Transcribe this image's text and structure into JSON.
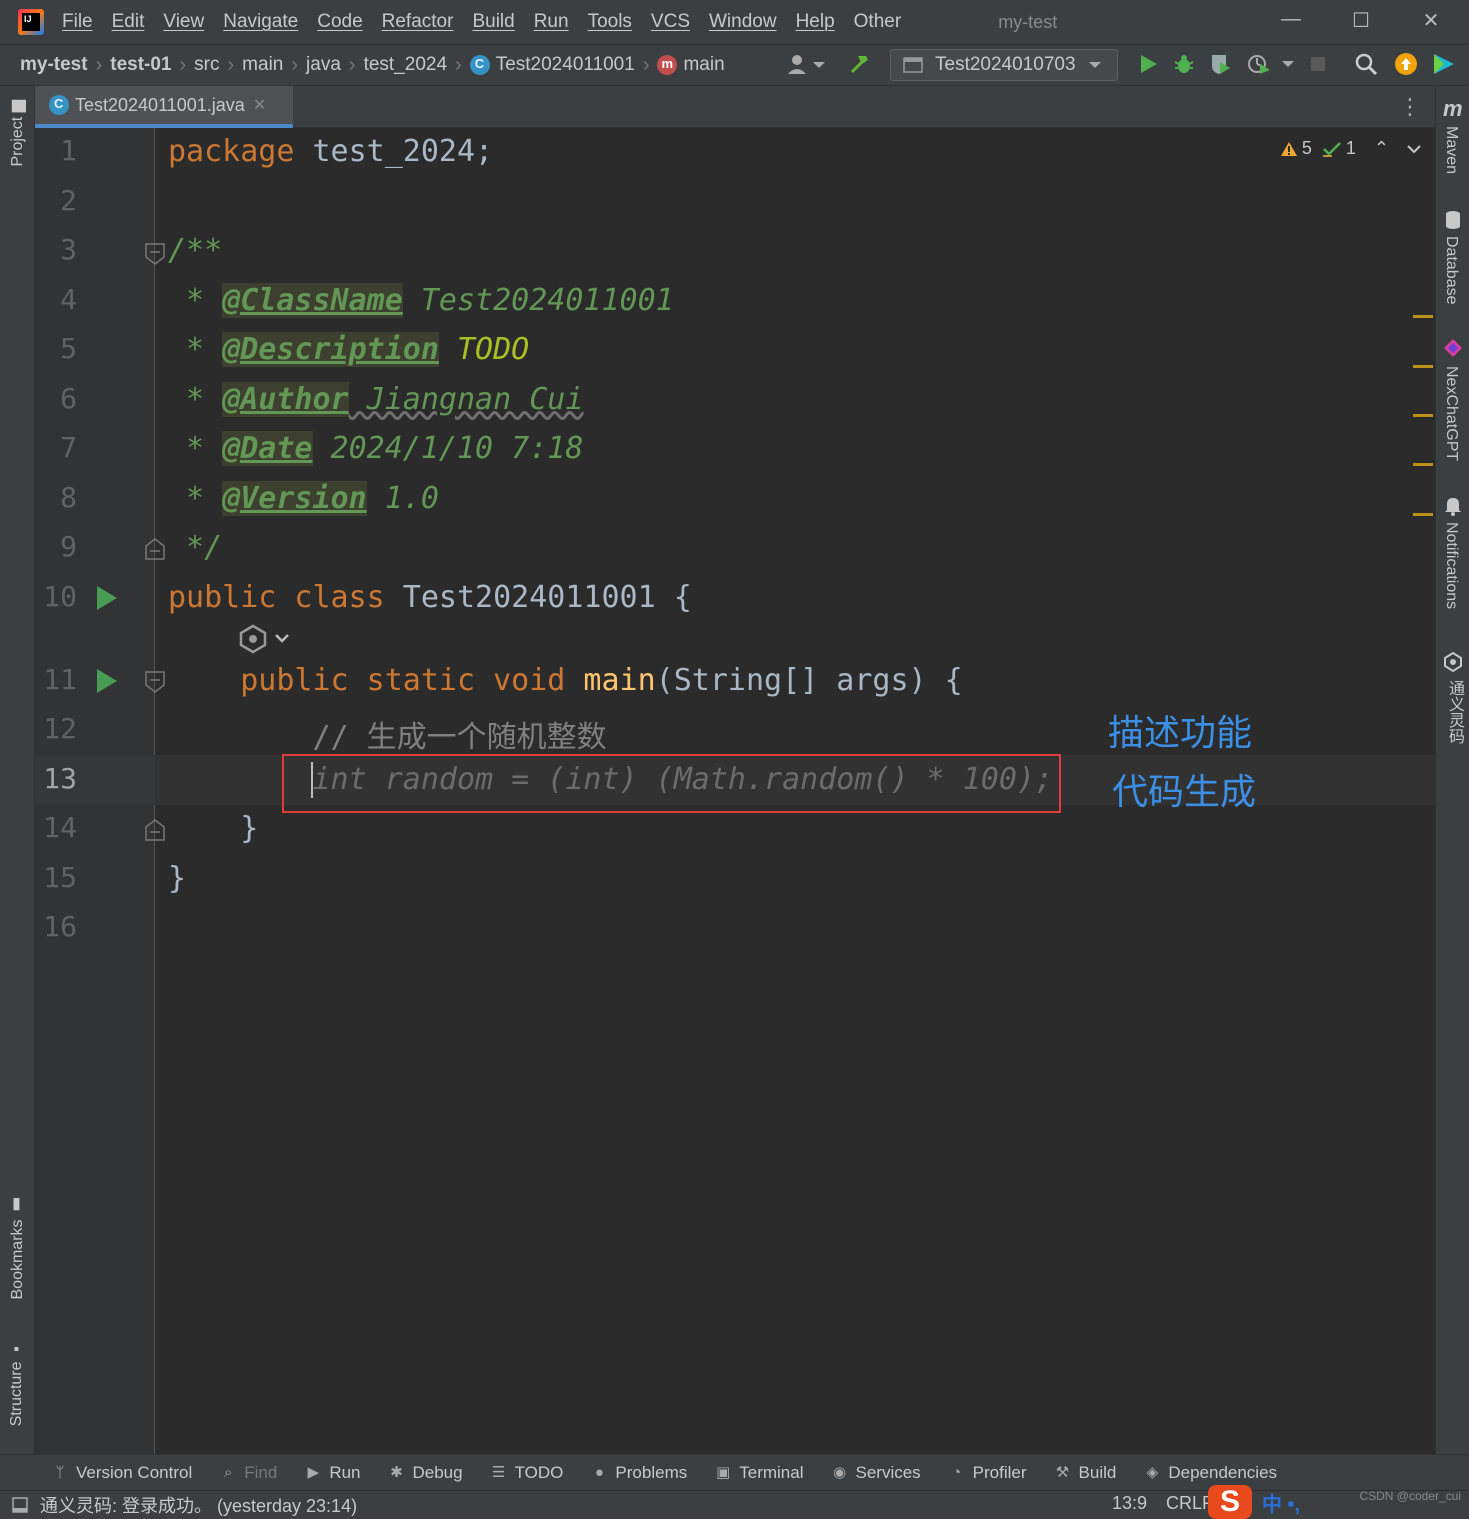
{
  "menubar": {
    "items": [
      "File",
      "Edit",
      "View",
      "Navigate",
      "Code",
      "Refactor",
      "Build",
      "Run",
      "Tools",
      "VCS",
      "Window",
      "Help",
      "Other"
    ],
    "window_title": "my-test"
  },
  "breadcrumbs": [
    "my-test",
    "test-01",
    "src",
    "main",
    "java",
    "test_2024",
    "Test2024011001",
    "main"
  ],
  "run_config": "Test2024010703",
  "tab": {
    "label": "Test2024011001.java"
  },
  "left_tools": [
    "Project",
    "Bookmarks",
    "Structure"
  ],
  "right_tools": [
    "Maven",
    "Database",
    "NexChatGPT",
    "Notifications",
    "通义灵码"
  ],
  "inspections": {
    "warnings": "5",
    "weak_warnings": "1"
  },
  "editor": {
    "line_numbers": [
      "1",
      "2",
      "3",
      "4",
      "5",
      "6",
      "7",
      "8",
      "9",
      "10",
      "11",
      "12",
      "13",
      "14",
      "15",
      "16"
    ],
    "current_line": "13",
    "code": {
      "l1_kw": "package",
      "l1_rest": " test_2024;",
      "l3": "/**",
      "l4_star": " * ",
      "l4_tag": "@ClassName",
      "l4_val": " Test2024011001",
      "l5_star": " * ",
      "l5_tag": "@Description",
      "l5_val": " TODO",
      "l6_star": " * ",
      "l6_tag": "@Author",
      "l6_val": " Jiangnan Cui",
      "l7_star": " * ",
      "l7_tag": "@Date",
      "l7_val": " 2024/1/10 7:18",
      "l8_star": " * ",
      "l8_tag": "@Version",
      "l8_val": " 1.0",
      "l9": " */",
      "l10_kw": "public class",
      "l10_rest": " Test2024011001 {",
      "l11_indent": "    ",
      "l11_kw": "public static void",
      "l11_fn": " main",
      "l11_rest": "(String[] args) {",
      "l12_indent": "        ",
      "l12_comment": "// 生成一个随机整数",
      "l13_indent": "        ",
      "l13_ghost": "int random = (int) (Math.random() * 100);",
      "l14": "    }",
      "l15": "}"
    }
  },
  "annotations": {
    "describe": "描述功能",
    "generate": "代码生成"
  },
  "bottom_tools": [
    "Version Control",
    "Find",
    "Run",
    "Debug",
    "TODO",
    "Problems",
    "Terminal",
    "Services",
    "Profiler",
    "Build",
    "Dependencies"
  ],
  "status": {
    "message": "通义灵码: 登录成功。 (yesterday 23:14)",
    "caret": "13:9",
    "line_separator": "CRLF",
    "ime_text": "中 •,",
    "watermark": "CSDN @coder_cui"
  },
  "colors": {
    "keyword": "#cc7832",
    "doc_comment": "#629755",
    "method": "#ffc66d",
    "accent": "#4a88c7",
    "annotation_blue": "#3b8fe5",
    "highlight_red": "#e03c3c"
  }
}
